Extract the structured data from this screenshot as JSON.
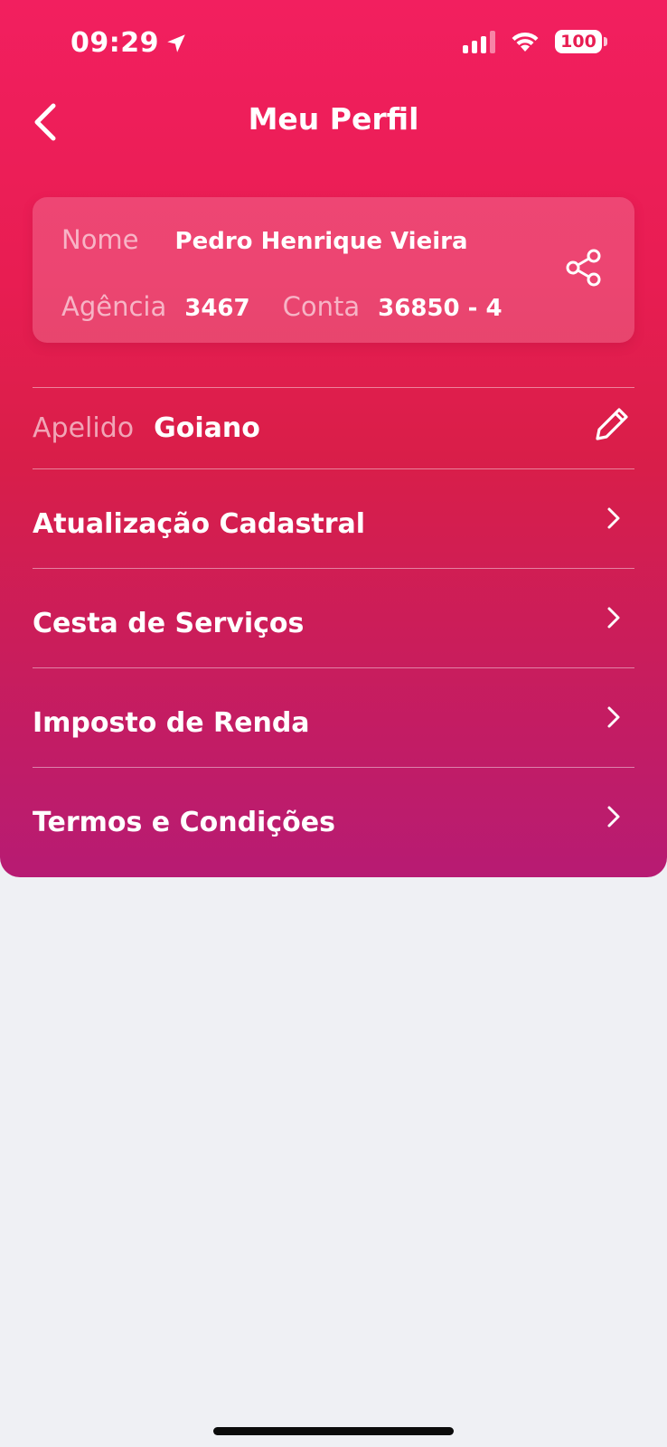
{
  "status_bar": {
    "time": "09:29",
    "battery": "100",
    "icons": [
      "location-arrow-icon",
      "signal-icon",
      "wifi-icon",
      "battery-icon"
    ]
  },
  "header": {
    "title": "Meu Perfil",
    "back_icon": "chevron-left-icon"
  },
  "profile": {
    "name_label": "Nome",
    "name_value": "Pedro Henrique Vieira",
    "agency_label": "Agência",
    "agency_value": "3467",
    "account_label": "Conta",
    "account_value": "36850 - 4",
    "share_icon": "share-icon"
  },
  "nickname": {
    "label": "Apelido",
    "value": "Goiano",
    "edit_icon": "pencil-icon"
  },
  "menu": [
    {
      "label": "Atualização Cadastral",
      "icon": "chevron-right-icon"
    },
    {
      "label": "Cesta de Serviços",
      "icon": "chevron-right-icon"
    },
    {
      "label": "Imposto de Renda",
      "icon": "chevron-right-icon"
    },
    {
      "label": "Termos e Condições",
      "icon": "chevron-right-icon"
    }
  ],
  "colors": {
    "gradient_top": "#f21f5f",
    "gradient_bottom": "#b71b73",
    "background": "#eff0f4"
  }
}
